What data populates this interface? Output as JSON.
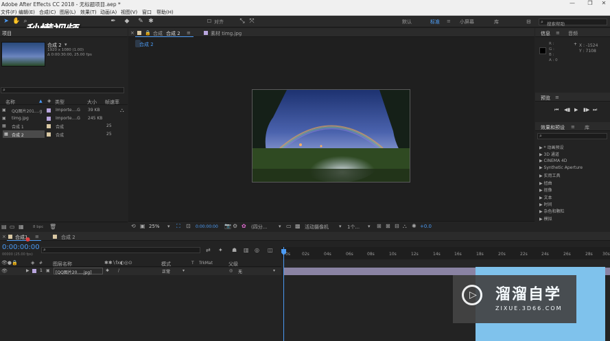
{
  "window": {
    "title": "Adobe After Effects CC 2018 - 无标题项目.aep *",
    "min": "—",
    "max": "❐",
    "close": "✕"
  },
  "menu": [
    "文件(F)",
    "编辑(E)",
    "合成(C)",
    "图层(L)",
    "效果(T)",
    "动画(A)",
    "视图(V)",
    "窗口",
    "帮助(H)"
  ],
  "toolbar": {
    "align_label": "对齐",
    "workspaces": [
      "默认",
      "标准",
      "小屏幕",
      "库"
    ],
    "active_workspace": "标准",
    "search_placeholder": "搜索帮助",
    "search_icon": "search-icon"
  },
  "watermark_logo": "秒懂视频",
  "project": {
    "panel_title": "项目",
    "selected_item": {
      "name": "合成 2",
      "line1": "1920 x 1080 (1.00)",
      "line2": "Δ 0:00:30:00, 25.00 fps"
    },
    "columns": {
      "name": "名称",
      "type": "类型",
      "size": "大小",
      "fps": "帧速率"
    },
    "items": [
      {
        "name": "QQ图片201....g",
        "type": "Importe....G",
        "size": "39 KB",
        "fps": "",
        "color": "#b9a6de",
        "selected": false
      },
      {
        "name": "timg.jpg",
        "type": "Importe....G",
        "size": "245 KB",
        "fps": "",
        "color": "#b9a6de",
        "selected": false
      },
      {
        "name": "合成 1",
        "type": "合成",
        "size": "",
        "fps": "25",
        "color": "#d9c8a3",
        "selected": false
      },
      {
        "name": "合成 2",
        "type": "合成",
        "size": "",
        "fps": "25",
        "color": "#d9c8a3",
        "selected": true
      }
    ],
    "bpc": "8 bpc"
  },
  "composition": {
    "tab_label": "合成",
    "tab_active": "合成 2",
    "footage_tab": "素材 timg.jpg",
    "breadcrumb": "合成 2",
    "zoom": "25%",
    "timecode": "0:00:00:00",
    "resolution": "(四分...",
    "camera": "活动摄像机",
    "views": "1个...",
    "exposure": "+0.0"
  },
  "info": {
    "tab_info": "信息",
    "tab_audio": "音频",
    "r": "R :",
    "g": "G :",
    "b": "B :",
    "a": "A : 0",
    "x": "X : -1524",
    "y": "Y : 7108"
  },
  "preview": {
    "title": "预览"
  },
  "effects": {
    "title": "效果和预设",
    "lib": "库",
    "items": [
      "* 动画预设",
      "3D 通道",
      "CINEMA 4D",
      "Synthetic Aperture",
      "实用工具",
      "扭曲",
      "抠像",
      "文本",
      "时间",
      "杂色和颗粒",
      "模拟"
    ]
  },
  "timeline": {
    "tab1": "合成1",
    "tab2": "合成 2",
    "timecode": "0:00:00:00",
    "sub_timecode": "00000 (25.00 fps)",
    "columns": {
      "layer_name": "图层名称",
      "mode": "模式",
      "t": "T",
      "trkmat": "TrkMat",
      "parent": "父级"
    },
    "layers": [
      {
        "index": "1",
        "name": "[QQ图片20.....jpg]",
        "mode": "正常",
        "parent": "无",
        "color": "#b9a6de"
      }
    ],
    "ruler": [
      "0s",
      "02s",
      "04s",
      "06s",
      "08s",
      "10s",
      "12s",
      "14s",
      "16s",
      "18s",
      "20s",
      "22s",
      "24s",
      "26s",
      "28s",
      "30s"
    ]
  },
  "corner_watermark": {
    "title": "溜溜自学",
    "url": "ZIXUE.3D66.COM"
  }
}
